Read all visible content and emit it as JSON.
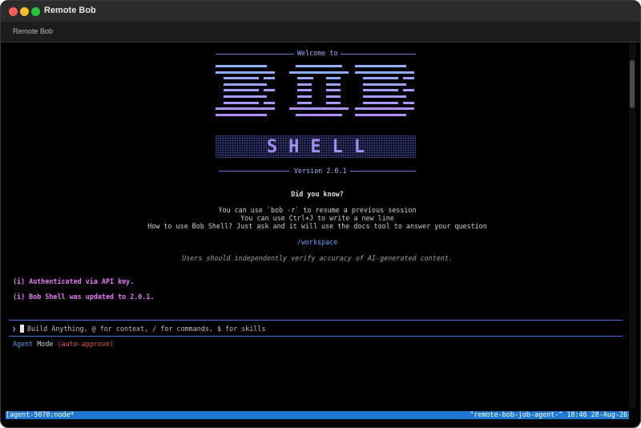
{
  "window": {
    "title": "Remote Bob",
    "tab_label": "Remote Bob"
  },
  "banner": {
    "welcome": "Welcome to",
    "logo_text": "BOB",
    "shell_text": "SHELL",
    "version": "Version 2.0.1"
  },
  "did_you_know": {
    "title": "Did you know?",
    "tips": [
      "You can use `bob -r` to resume a previous session",
      "You can use Ctrl+J to write a new line",
      "How to use Bob Shell? Just ask and it will use the docs tool to answer your question"
    ]
  },
  "workspace_path": "/workspace",
  "disclaimer": "Users should independently verify accuracy of AI-generated content.",
  "notices": [
    "(i) Authenticated via API key.",
    "(i) Bob Shell was updated to 2.0.1."
  ],
  "input": {
    "prompt_symbol": "❯",
    "placeholder": "Build Anything, @ for context, / for commands, $ for skills"
  },
  "mode": {
    "agent": "Agent",
    "label": "Mode",
    "approval": "(auto-approve)"
  },
  "status_bar": {
    "left": "[agent-5070:node*",
    "right": "\"remote-bob-job-agent-\" 18:46 28-Aug-26"
  },
  "colors": {
    "logo_top": "#8fb0ff",
    "logo_bottom": "#b48cf5",
    "accent": "#6d7bd6",
    "notice": "#e879f9",
    "status_bar": "#1f78d1"
  }
}
